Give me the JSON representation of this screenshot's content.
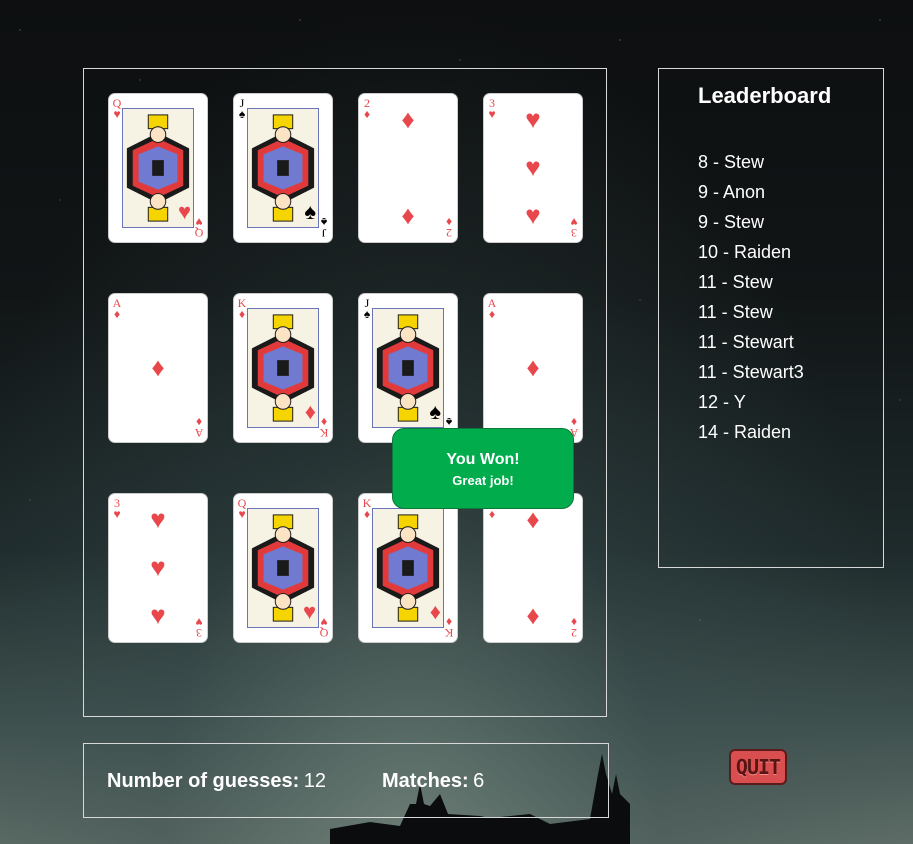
{
  "cards": [
    {
      "rank": "Q",
      "suit": "♥",
      "color": "red",
      "face": true
    },
    {
      "rank": "J",
      "suit": "♠",
      "color": "black",
      "face": true
    },
    {
      "rank": "2",
      "suit": "♦",
      "color": "red",
      "face": false
    },
    {
      "rank": "3",
      "suit": "♥",
      "color": "red",
      "face": false
    },
    {
      "rank": "A",
      "suit": "♦",
      "color": "red",
      "face": false
    },
    {
      "rank": "K",
      "suit": "♦",
      "color": "red",
      "face": true
    },
    {
      "rank": "J",
      "suit": "♠",
      "color": "black",
      "face": true
    },
    {
      "rank": "A",
      "suit": "♦",
      "color": "red",
      "face": false
    },
    {
      "rank": "3",
      "suit": "♥",
      "color": "red",
      "face": false
    },
    {
      "rank": "Q",
      "suit": "♥",
      "color": "red",
      "face": true
    },
    {
      "rank": "K",
      "suit": "♦",
      "color": "red",
      "face": true
    },
    {
      "rank": "2",
      "suit": "♦",
      "color": "red",
      "face": false
    }
  ],
  "popup": {
    "title": "You Won!",
    "subtitle": "Great job!"
  },
  "leaderboard": {
    "title": "Leaderboard",
    "entries": [
      "8 - Stew",
      "9 - Anon",
      "9 - Stew",
      "10 - Raiden",
      "11 - Stew",
      "11 - Stew",
      "11 - Stewart",
      "11 - Stewart3",
      "12 - Y",
      "14 - Raiden"
    ]
  },
  "stats": {
    "guesses_label": "Number of guesses:",
    "guesses_value": "12",
    "matches_label": "Matches:",
    "matches_value": "6"
  },
  "quit_label": "QUIT",
  "colors": {
    "popup": "#00ac4c",
    "red_suit": "#e8474c",
    "quit": "#d94e4e"
  }
}
